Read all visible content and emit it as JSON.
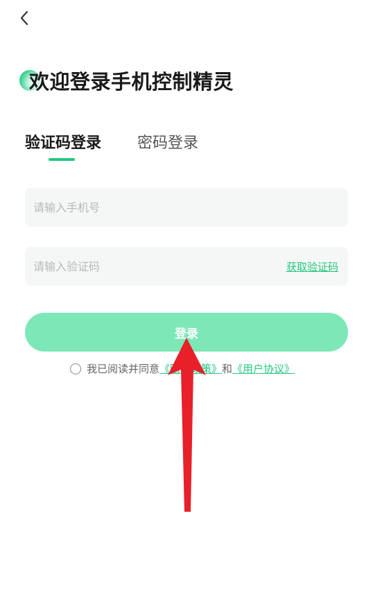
{
  "header": {
    "back_icon": "chevron-left-icon",
    "title": "欢迎登录手机控制精灵"
  },
  "tabs": [
    {
      "label": "验证码登录",
      "active": true
    },
    {
      "label": "密码登录",
      "active": false
    }
  ],
  "form": {
    "phone_placeholder": "请输入手机号",
    "phone_value": "",
    "code_placeholder": "请输入验证码",
    "code_value": "",
    "get_code_label": "获取验证码"
  },
  "login_button": {
    "label": "登录"
  },
  "agreement": {
    "checked": false,
    "prefix": "我已阅读并同意",
    "privacy_link": "《隐私政策》",
    "conjunction": "和",
    "terms_link": "《用户协议》"
  },
  "colors": {
    "accent": "#23c77f",
    "button_bg": "#7ee7b8",
    "field_bg": "#f5f7f6",
    "annotation_arrow": "#e8202a"
  }
}
